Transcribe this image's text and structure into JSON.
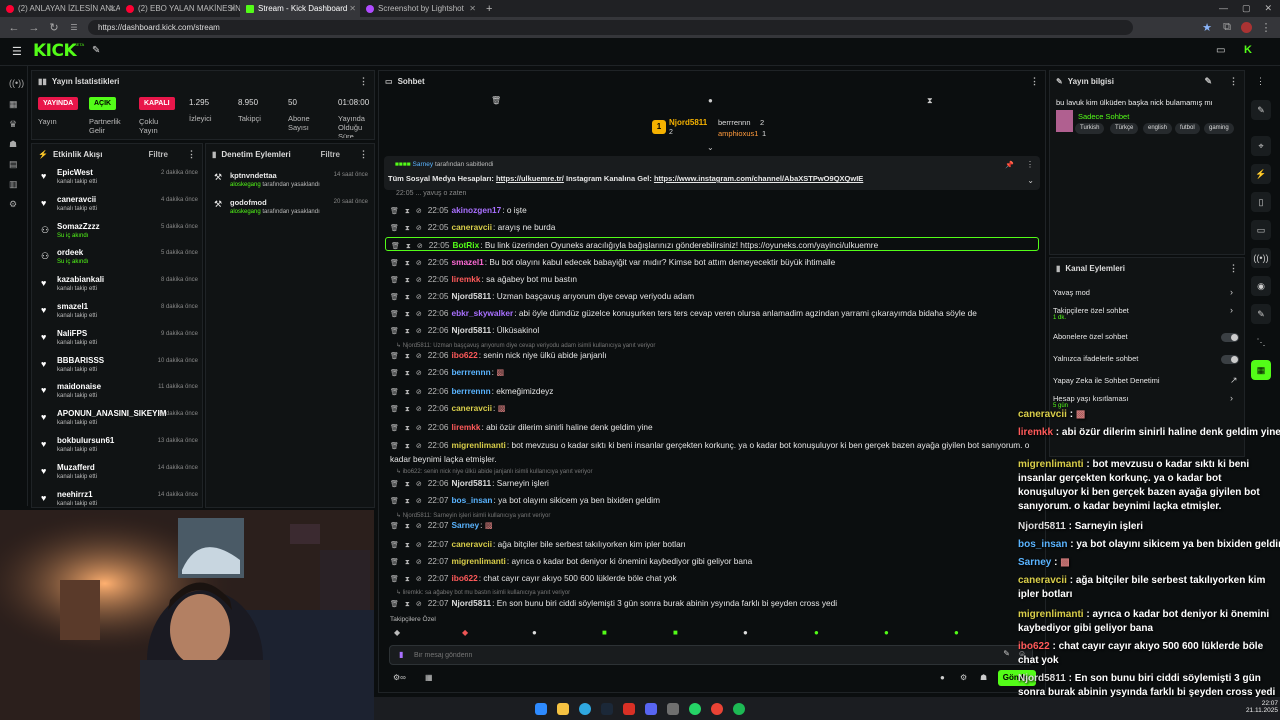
{
  "browser": {
    "tabs": [
      {
        "label": "(2) ANLAYAN İZLESİN ANLAMAYA",
        "icon": "youtube-icon",
        "color": "#ff0033"
      },
      {
        "label": "(2) EBO YALAN MAKİNESİNDE! K",
        "icon": "youtube-icon",
        "color": "#ff0033"
      },
      {
        "label": "Stream - Kick Dashboard",
        "icon": "kick-icon",
        "color": "#53fc18"
      },
      {
        "label": "Screenshot by Lightshot",
        "icon": "lightshot-icon",
        "color": "#b04bff"
      }
    ],
    "url": "https://dashboard.kick.com/stream"
  },
  "brand": {
    "logo": "KICK",
    "beta": "BETA",
    "accent": "#53fc18"
  },
  "stats": {
    "title": "Yayın İstatistikleri",
    "live_badge": "YAYINDA",
    "live_label": "Yayın",
    "partner_badge": "AÇIK",
    "partner_label": "Partnerlik Gelir",
    "multi_badge": "KAPALI",
    "multi_label": "Çoklu Yayın",
    "viewers": "1.295",
    "viewers_label": "İzleyici",
    "followers": "8.950",
    "followers_label": "Takipçi",
    "subs": "50",
    "subs_label": "Abone Sayısı",
    "uptime": "01:08:00",
    "uptime_label": "Yayında Olduğu Süre"
  },
  "activity": {
    "title": "Etkinlik Akışı",
    "filter": "Filtre",
    "items": [
      {
        "name": "EpicWest",
        "sub": "kanalı takip etti",
        "time": "2 dakika önce",
        "icon": "heart-icon"
      },
      {
        "name": "caneravcii",
        "sub": "kanalı takip etti",
        "time": "4 dakika önce",
        "icon": "heart-icon"
      },
      {
        "name": "SomazZzzz",
        "sub": "Su iç akındı",
        "time": "5 dakika önce",
        "icon": "points-icon"
      },
      {
        "name": "ordeek",
        "sub": "Su iç akındı",
        "time": "5 dakika önce",
        "icon": "points-icon"
      },
      {
        "name": "kazabiankali",
        "sub": "kanalı takip etti",
        "time": "8 dakika önce",
        "icon": "heart-icon"
      },
      {
        "name": "smazel1",
        "sub": "kanalı takip etti",
        "time": "8 dakika önce",
        "icon": "heart-icon"
      },
      {
        "name": "NaliFPS",
        "sub": "kanalı takip etti",
        "time": "9 dakika önce",
        "icon": "heart-icon"
      },
      {
        "name": "BBBARISSS",
        "sub": "kanalı takip etti",
        "time": "10 dakika önce",
        "icon": "heart-icon"
      },
      {
        "name": "maidonaise",
        "sub": "kanalı takip etti",
        "time": "11 dakika önce",
        "icon": "heart-icon"
      },
      {
        "name": "APONUN_ANASINI_SIKEYIM",
        "sub": "kanalı takip etti",
        "time": "11 dakika önce",
        "icon": "heart-icon"
      },
      {
        "name": "bokbulursun61",
        "sub": "kanalı takip etti",
        "time": "13 dakika önce",
        "icon": "heart-icon"
      },
      {
        "name": "Muzafferd",
        "sub": "kanalı takip etti",
        "time": "14 dakika önce",
        "icon": "heart-icon"
      },
      {
        "name": "neehirrz1",
        "sub": "kanalı takip etti",
        "time": "14 dakika önce",
        "icon": "heart-icon"
      }
    ]
  },
  "moderation": {
    "title": "Denetim Eylemleri",
    "filter": "Filtre",
    "items": [
      {
        "name": "kptnvndettaa",
        "by": "aloskegang",
        "action": "tarafından yasaklandı",
        "time": "14 saat önce"
      },
      {
        "name": "godofmod",
        "by": "aloskegang",
        "action": "tarafından yasaklandı",
        "time": "20 saat önce"
      }
    ]
  },
  "chat": {
    "title": "Sohbet",
    "top_user": "Njord5811",
    "top_count": "2",
    "top2_user": "berrrennn",
    "top2_count": "2",
    "top3_user": "amphioxus1",
    "top3_count": "1",
    "pinned_by": "Sarney",
    "pinned_suffix": "tarafından sabitlendi",
    "pinned_prefix": "Tüm Sosyal Medya Hesapları: ",
    "pinned_link1": "https://ulkuemre.tr/",
    "pinned_mid": " Instagram Kanalına Gel: ",
    "pinned_link2": "https://www.instagram.com/channel/AbaXSTPwO9QXQwIE",
    "clipped_line": "22:05 ... yavuş o zaten",
    "messages": [
      {
        "time": "22:05",
        "user": "akinozgen17",
        "color": "#a970ff",
        "text": "o işte"
      },
      {
        "time": "22:05",
        "user": "caneravcii",
        "color": "#d9ce4a",
        "text": "arayış ne burda"
      },
      {
        "time": "22:05",
        "user": "BotRix",
        "color": "#53fc18",
        "text": "Bu link üzerinden Oyuneks aracılığıyla bağışlarınızı gönderebilirsiniz! https://oyuneks.com/yayinci/ulkuemre"
      },
      {
        "time": "22:05",
        "user": "smazel1",
        "color": "#ff6bd6",
        "text": "Bu bot olayını kabul edecek babayiğit var mıdır? Kimse bot attım demeyecektir büyük ihtimalle"
      },
      {
        "time": "22:05",
        "user": "liremkk",
        "color": "#ff5a5a",
        "text": "sa ağabey bot mu bastın"
      },
      {
        "time": "22:05",
        "user": "Njord5811",
        "color": "#dcdcdc",
        "text": "Uzman başçavuş arıyorum diye cevap veriyodu adam"
      },
      {
        "time": "22:06",
        "user": "ebkr_skywalker",
        "color": "#a970ff",
        "text": "abi öyle dümdüz güzelce konuşurken ters ters cevap veren olursa anlamadim agzindan yarrami çıkarayımda bidaha söyle de"
      },
      {
        "time": "22:06",
        "user": "Njord5811",
        "color": "#dcdcdc",
        "text": "Ülküsakinol"
      },
      {
        "time": "22:06",
        "user": "ibo622",
        "color": "#ff5a5a",
        "text": "senin nick niye ülkü abide janjanlı"
      },
      {
        "time": "22:06",
        "user": "berrrennn",
        "color": "#5ab4ff",
        "text": ""
      },
      {
        "time": "22:06",
        "user": "berrrennn",
        "color": "#5ab4ff",
        "text": "ekmeğimizdeyz"
      },
      {
        "time": "22:06",
        "user": "caneravcii",
        "color": "#d9ce4a",
        "text": ""
      },
      {
        "time": "22:06",
        "user": "liremkk",
        "color": "#ff5a5a",
        "text": "abi özür dilerim sinirli haline denk geldim yine"
      },
      {
        "time": "22:06",
        "user": "migrenlimanti",
        "color": "#d9ce4a",
        "text": "bot mevzusu o kadar sıktı ki beni insanlar gerçekten korkunç. ya o kadar bot konuşuluyor ki ben gerçek bazen ayağa giyilen bot sanıyorum. o kadar beynimi laçka etmişler."
      },
      {
        "time": "22:06",
        "user": "Njord5811",
        "color": "#dcdcdc",
        "text": "Sarneyin işleri"
      },
      {
        "time": "22:07",
        "user": "bos_insan",
        "color": "#5ab4ff",
        "text": "ya bot olayını sikicem ya ben bixiden geldim"
      },
      {
        "time": "22:07",
        "user": "Sarney",
        "color": "#5ab4ff",
        "text": ""
      },
      {
        "time": "22:07",
        "user": "caneravcii",
        "color": "#d9ce4a",
        "text": "ağa bitçiler bile serbest takılıyorken kim ipler botları"
      },
      {
        "time": "22:07",
        "user": "migrenlimanti",
        "color": "#d9ce4a",
        "text": "ayrıca o kadar bot deniyor ki önemini kaybediyor gibi geliyor bana"
      },
      {
        "time": "22:07",
        "user": "ibo622",
        "color": "#ff5a5a",
        "text": "chat cayır cayır akıyo 500 600 lüklerde böle chat yok"
      },
      {
        "time": "22:07",
        "user": "Njord5811",
        "color": "#dcdcdc",
        "text": "En son bunu biri ciddi söylemişti 3 gün sonra burak abinin ysyında farklı bi şeyden cross yedi"
      }
    ],
    "replies": [
      "Njord5811: Uzman başçavuş arıyorum diye cevap veriyodu adam isimli kullanıcıya yanıt veriyor",
      "ibo622: senin nick niye ülkü abide janjanlı isimli kullanıcıya yanıt veriyor",
      "Njord5811: Sarneyin işleri isimli kullanıcıya yanıt veriyor",
      "liremkk: sa ağabey bot mu bastın isimli kullanıcıya yanıt veriyor"
    ],
    "followers_only": "Takipçilere Özel",
    "placeholder": "Bir mesaj gönderin",
    "send": "Gönder"
  },
  "stream_info": {
    "title": "Yayın bilgisi",
    "stream_title": "bu lavuk kim ülküden başka nick bulamamış mı",
    "category": "Sadece Sohbet",
    "tags": [
      "Turkish",
      "Türkçe",
      "english",
      "futbol",
      "gaming"
    ]
  },
  "channel_actions": {
    "title": "Kanal Eylemleri",
    "items": [
      {
        "label": "Yavaş mod",
        "control": "chevron"
      },
      {
        "label": "Takipçilere özel sohbet",
        "sub": "1 dk.",
        "control": "chevron"
      },
      {
        "label": "Abonelere özel sohbet",
        "control": "toggle"
      },
      {
        "label": "Yalnızca ifadelerle sohbet",
        "control": "toggle"
      },
      {
        "label": "Yapay Zeka ile Sohbet Denetimi",
        "control": "external"
      },
      {
        "label": "Hesap yaşı kısıtlaması",
        "sub": "5 gün",
        "control": "chevron"
      },
      {
        "label": "Yasaklanmış kelimeler",
        "control": "chevron"
      },
      {
        "label": "İzleyici Yönlendir",
        "control": "chevron"
      }
    ]
  },
  "overlay_chat": [
    {
      "user": "caneravcii",
      "color": "#d9ce4a",
      "text": ""
    },
    {
      "user": "liremkk",
      "color": "#ff5a5a",
      "text": "abi özür dilerim sinirli haline denk geldim yine"
    },
    {
      "user": "migrenlimanti",
      "color": "#d9ce4a",
      "text": "bot mevzusu o kadar sıktı ki beni insanlar gerçekten korkunç. ya o kadar bot konuşuluyor ki ben gerçek bazen ayağa giyilen bot sanıyorum. o kadar beynimi laçka etmişler."
    },
    {
      "user": "Njord5811",
      "color": "#dcdcdc",
      "text": "Sarneyin işleri"
    },
    {
      "user": "bos_insan",
      "color": "#5ab4ff",
      "text": "ya bot olayını sikicem ya ben bixiden geldim"
    },
    {
      "user": "Sarney",
      "color": "#5ab4ff",
      "text": ""
    },
    {
      "user": "caneravcii",
      "color": "#d9ce4a",
      "text": "ağa bitçiler bile serbest takılıyorken kim ipler botları"
    },
    {
      "user": "migrenlimanti",
      "color": "#d9ce4a",
      "text": "ayrıca o kadar bot deniyor ki önemini kaybediyor gibi geliyor bana"
    },
    {
      "user": "ibo622",
      "color": "#ff5a5a",
      "text": "chat cayır cayır akıyo 500 600 lüklerde böle chat yok"
    },
    {
      "user": "Njord5811",
      "color": "#dcdcdc",
      "text": "En son bunu biri ciddi söylemişti 3 gün sonra burak abinin ysyında farklı bi şeyden cross yedi"
    }
  ],
  "clock": {
    "time": "22:07",
    "date": "21.11.2025"
  }
}
